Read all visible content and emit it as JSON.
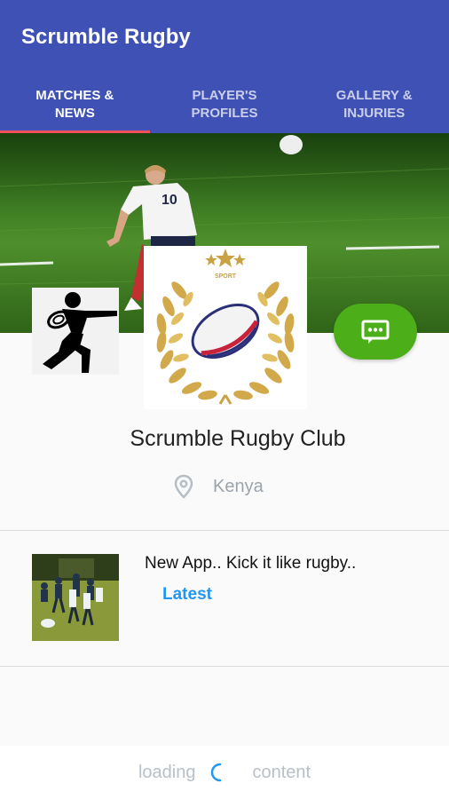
{
  "app": {
    "title": "Scrumble Rugby"
  },
  "tabs": [
    {
      "label": "MATCHES &\nNEWS",
      "active": true
    },
    {
      "label": "PLAYER'S\nPROFILES",
      "active": false
    },
    {
      "label": "GALLERY &\nINJURIES",
      "active": false
    }
  ],
  "cover": {
    "player_number": "10"
  },
  "club": {
    "name": "Scrumble Rugby Club",
    "location": "Kenya",
    "badge_text": "SPORT"
  },
  "news": [
    {
      "title": "New App.. Kick it like rugby..",
      "tag": "Latest"
    }
  ],
  "footer": {
    "left_text": "loading",
    "right_text": "content"
  },
  "colors": {
    "primary": "#3f51b5",
    "accent": "#ef4e5a",
    "chat": "#4caf19",
    "link": "#2196f3"
  }
}
